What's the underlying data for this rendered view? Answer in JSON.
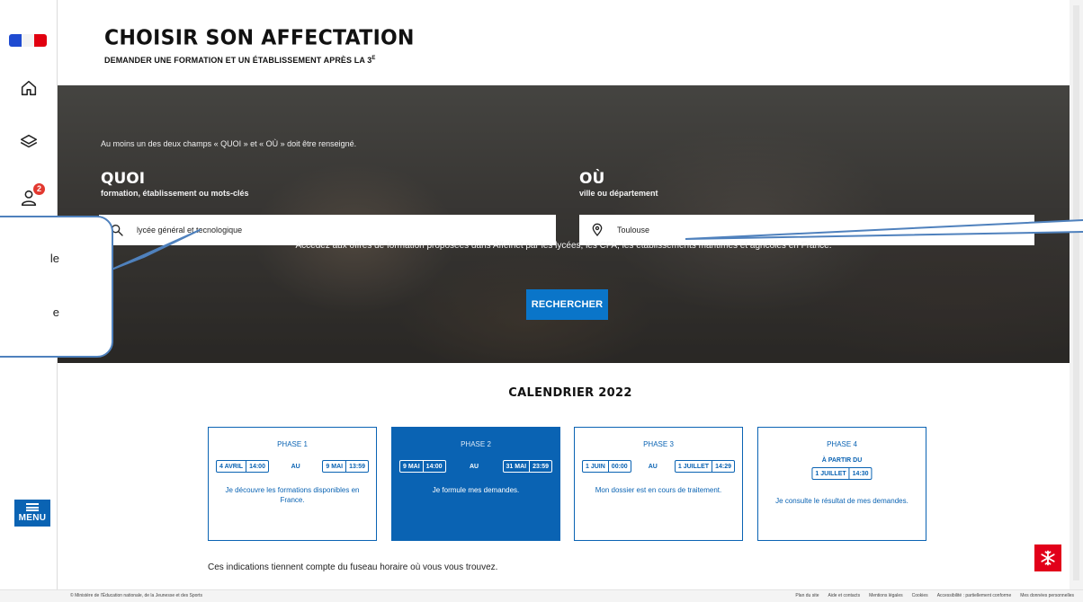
{
  "header": {
    "title": "CHOISIR SON AFFECTATION",
    "subtitle": "DEMANDER UNE FORMATION ET UN ÉTABLISSEMENT APRÈS LA 3",
    "subtitle_sup": "E"
  },
  "sidebar": {
    "profile_badge": "2",
    "menu_label": "MENU",
    "icons": [
      "home-icon",
      "layers-icon",
      "user-icon"
    ]
  },
  "search": {
    "note": "Au moins un des deux champs « QUOI » et « OÙ » doit être renseigné.",
    "quoi": {
      "title": "QUOI",
      "sub": "formation, établissement ou mots-clés",
      "value": "lycée général et tecnologique"
    },
    "ou": {
      "title": "OÙ",
      "sub": "ville ou département",
      "value": "Toulouse"
    },
    "description": "Accédez aux offres de formation proposées dans Affelnet par les lycées, les CFA, les établissements maritimes et agricoles en France.",
    "button": "RECHERCHER"
  },
  "callout": {
    "line1": "le",
    "line2": "e"
  },
  "calendar": {
    "title": "CALENDRIER 2022",
    "au": "AU",
    "phases": [
      {
        "name": "PHASE 1",
        "start_day": "4 AVRIL",
        "start_time": "14:00",
        "end_day": "9 MAI",
        "end_time": "13:59",
        "desc": "Je découvre les formations disponibles en France."
      },
      {
        "name": "PHASE 2",
        "start_day": "9 MAI",
        "start_time": "14:00",
        "end_day": "31 MAI",
        "end_time": "23:59",
        "desc": "Je formule mes demandes."
      },
      {
        "name": "PHASE 3",
        "start_day": "1 JUIN",
        "start_time": "00:00",
        "end_day": "1 JUILLET",
        "end_time": "14:29",
        "desc": "Mon dossier est en cours de traitement."
      },
      {
        "name": "PHASE 4",
        "from": "À PARTIR DU",
        "start_day": "1 JUILLET",
        "start_time": "14:30",
        "desc": "Je consulte le résultat de mes demandes."
      }
    ],
    "timezone_note": "Ces indications tiennent compte du fuseau horaire où vous vous trouvez."
  },
  "footer": {
    "copyright": "© Ministère de l'Éducation nationale, de la Jeunesse et des Sports",
    "links": [
      "Plan du site",
      "Aide et contacts",
      "Mentions légales",
      "Cookies",
      "Accessibilité : partiellement conforme",
      "Mes données personnelles"
    ]
  },
  "colors": {
    "primary": "#0a63b3",
    "button": "#0a75c9",
    "badge": "#e2382f",
    "logo": "#e2001a",
    "callout_border": "#4f81bd"
  }
}
